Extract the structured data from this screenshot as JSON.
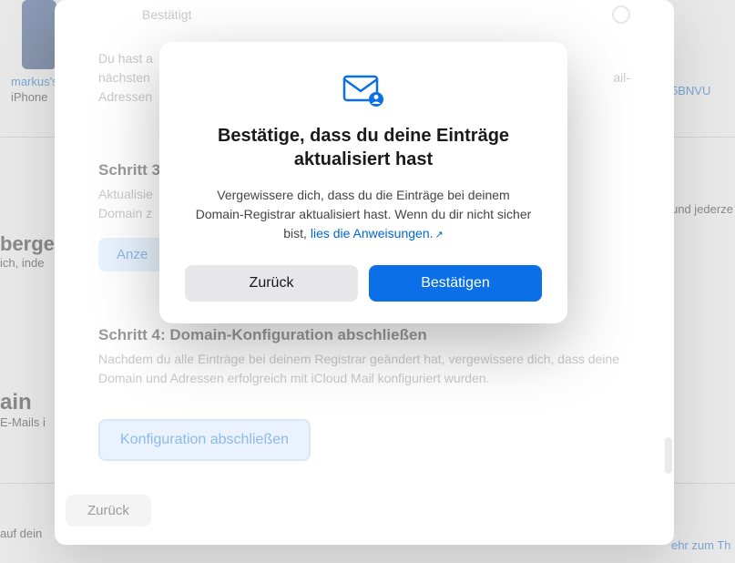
{
  "background": {
    "device_label_1": "markus's",
    "device_label_2": "iPhone",
    "right_code": "5BNVU",
    "left_heading_frag": "berge",
    "left_sub_frag": "ich, inde",
    "left_heading2_frag": "ain",
    "left_sub2_frag": "E-Mails i",
    "right_text_frag": "und jederze",
    "right_link_frag": "ehr zum Th",
    "bottom_text_frag": "auf dein"
  },
  "first_modal": {
    "confirmed_label": "Bestätigt",
    "step2_desc_line1": "Du hast a",
    "step2_desc_line2": "nächsten",
    "step2_desc_line3": "Adressen",
    "step2_mail_frag": "ail-",
    "step3_title": "Schritt 3",
    "step3_desc_line1": "Aktualisie",
    "step3_desc_line2": "Domain z",
    "step3_button": "Anze",
    "step4_title": "Schritt 4: Domain-Konfiguration abschließen",
    "step4_desc": "Nachdem du alle Einträge bei deinem Registrar geändert hat, vergewissere dich, dass deine Domain und Adressen erfolgreich mit iCloud Mail konfiguriert wurden.",
    "step4_button": "Konfiguration abschließen",
    "back_button": "Zurück"
  },
  "dialog": {
    "title": "Bestätige, dass du deine Einträge aktualisiert hast",
    "body_text": "Vergewissere dich, dass du die Einträge bei deinem Domain-Registrar aktualisiert hast. Wenn du dir nicht sicher bist, ",
    "body_link": "lies die Anweisungen.",
    "cancel": "Zurück",
    "confirm": "Bestätigen"
  }
}
